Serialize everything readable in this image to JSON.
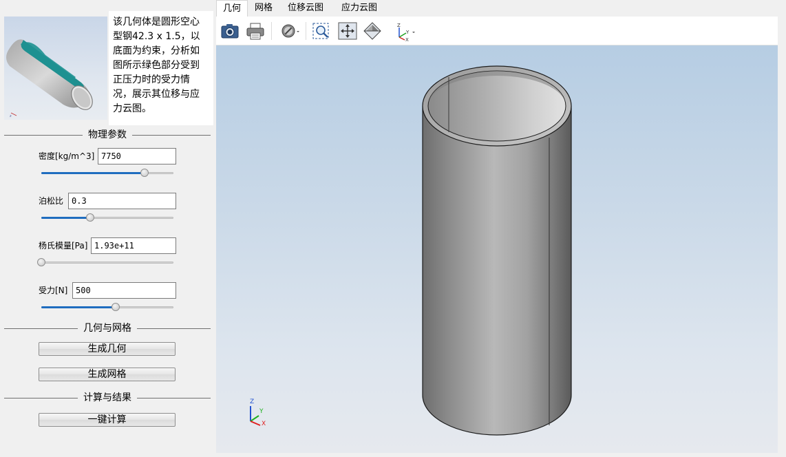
{
  "description": {
    "lines": [
      "该几何体是圆形空心",
      "型钢42.3 x 1.5，以",
      "底面为约束，分析如",
      "图所示绿色部分受到",
      "正压力时的受力情",
      "况，展示其位移与应",
      "力云图。"
    ]
  },
  "sections": {
    "physical": "物理参数",
    "geometry_mesh": "几何与网格",
    "compute_result": "计算与结果"
  },
  "params": {
    "density": {
      "label": "密度[kg/m^3]",
      "value": "7750",
      "slider": 0.78
    },
    "poisson": {
      "label": "泊松比",
      "value": "0.3",
      "slider": 0.37
    },
    "young": {
      "label": "杨氏模量[Pa]",
      "value": "1.93e+11",
      "slider": 0.0
    },
    "force": {
      "label": "受力[N]",
      "value": "500",
      "slider": 0.56
    }
  },
  "buttons": {
    "gen_geometry": "生成几何",
    "gen_mesh": "生成网格",
    "compute": "一键计算"
  },
  "tabs": [
    "几何",
    "网格",
    "位移云图",
    "应力云图"
  ],
  "active_tab": "几何",
  "axes": {
    "z": "Z",
    "y": "Y",
    "x": "X"
  },
  "colors": {
    "accent": "#1f6dbf",
    "thumb_face": "#1f8f8f",
    "axis_x": "#e02020",
    "axis_y": "#20b020",
    "axis_z": "#2050d0"
  }
}
